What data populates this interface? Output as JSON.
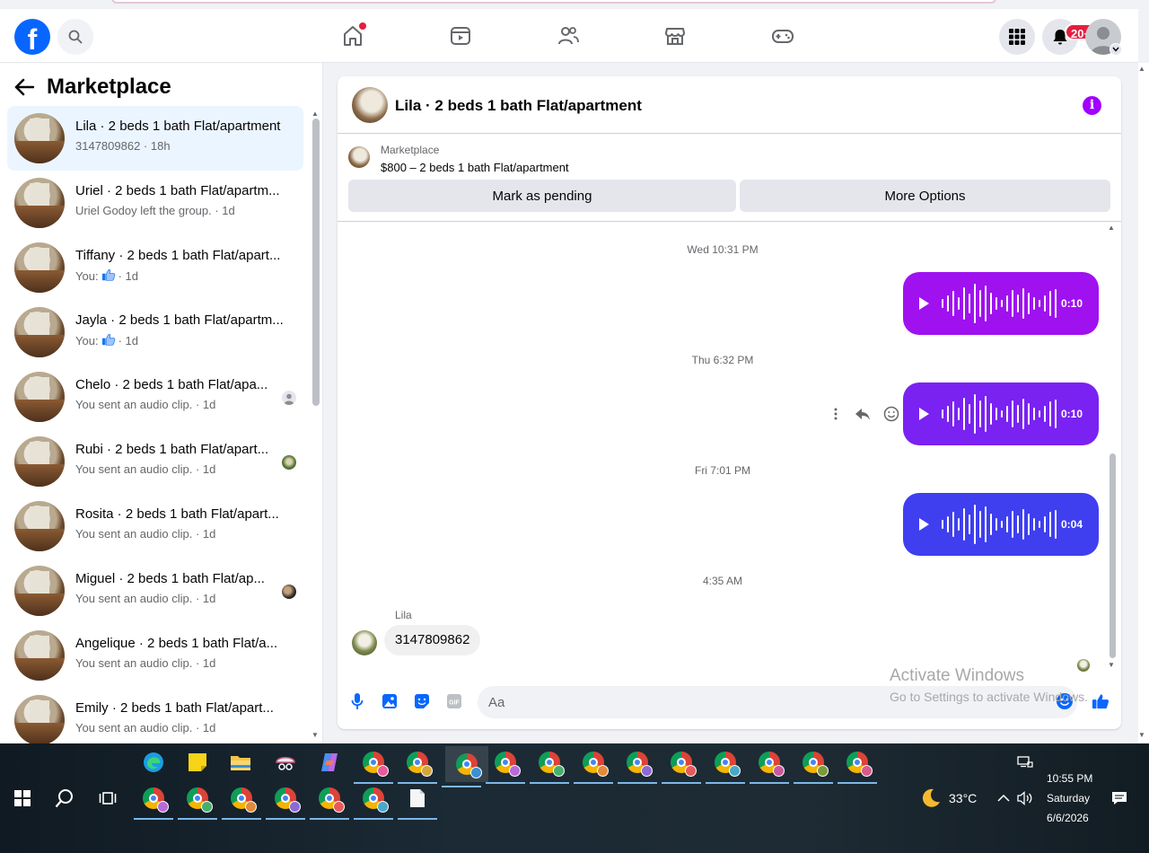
{
  "navbar": {
    "notification_badge": "20+"
  },
  "sidebar": {
    "title": "Marketplace",
    "conversations": [
      {
        "name": "Lila · 2 beds 1 bath Flat/apartment",
        "sub": "3147809862 · 18h",
        "active": true,
        "mini": ""
      },
      {
        "name": "Uriel · 2 beds 1 bath Flat/apartm...",
        "sub": "Uriel Godoy left the group. · 1d",
        "active": false,
        "mini": ""
      },
      {
        "name": "Tiffany · 2 beds 1 bath Flat/apart...",
        "sub_prefix": "You:",
        "sub_suffix": "· 1d",
        "like": true,
        "active": false,
        "mini": ""
      },
      {
        "name": "Jayla · 2 beds 1 bath Flat/apartm...",
        "sub_prefix": "You:",
        "sub_suffix": "· 1d",
        "like": true,
        "active": false,
        "mini": ""
      },
      {
        "name": "Chelo · 2 beds 1 bath Flat/apa...",
        "sub": "You sent an audio clip. · 1d",
        "active": false,
        "mini": "default-avatar-icon"
      },
      {
        "name": "Rubi · 2 beds 1 bath Flat/apart...",
        "sub": "You sent an audio clip. · 1d",
        "active": false,
        "mini": "photo-avatar-green"
      },
      {
        "name": "Rosita · 2 beds 1 bath Flat/apart...",
        "sub": "You sent an audio clip. · 1d",
        "active": false,
        "mini": ""
      },
      {
        "name": "Miguel · 2 beds 1 bath Flat/ap...",
        "sub": "You sent an audio clip. · 1d",
        "active": false,
        "mini": "photo-avatar-dark"
      },
      {
        "name": "Angelique · 2 beds 1 bath Flat/a...",
        "sub": "You sent an audio clip. · 1d",
        "active": false,
        "mini": ""
      },
      {
        "name": "Emily · 2 beds 1 bath Flat/apart...",
        "sub": "You sent an audio clip. · 1d",
        "active": false,
        "mini": ""
      }
    ]
  },
  "chat": {
    "title": "Lila · 2 beds 1 bath Flat/apartment",
    "marketplace_label": "Marketplace",
    "listing": "$800 – 2 beds 1 bath Flat/apartment",
    "mark_pending": "Mark as pending",
    "more_options": "More Options",
    "messages": [
      {
        "type": "timestamp",
        "text": "Wed 10:31 PM"
      },
      {
        "type": "voice",
        "duration": "0:10",
        "color": "#a011f0"
      },
      {
        "type": "timestamp",
        "text": "Thu 6:32 PM"
      },
      {
        "type": "voice",
        "duration": "0:10",
        "color": "#7a22f2"
      },
      {
        "type": "timestamp",
        "text": "Fri 7:01 PM"
      },
      {
        "type": "voice",
        "duration": "0:04",
        "color": "#3f3ff0"
      },
      {
        "type": "timestamp",
        "text": "4:35 AM"
      },
      {
        "type": "received",
        "sender": "Lila",
        "text": "3147809862"
      }
    ],
    "composer_placeholder": "Aa"
  },
  "watermark": {
    "line1": "Activate Windows",
    "line2": "Go to Settings to activate Windows."
  },
  "taskbar": {
    "weather_temp": "33°C",
    "time": "10:55 PM",
    "day": "Saturday",
    "date": "6/6/2026"
  },
  "colors": {
    "brand": "#0866ff",
    "active_conv": "#ebf5ff",
    "info_icon": "#a200ff"
  }
}
